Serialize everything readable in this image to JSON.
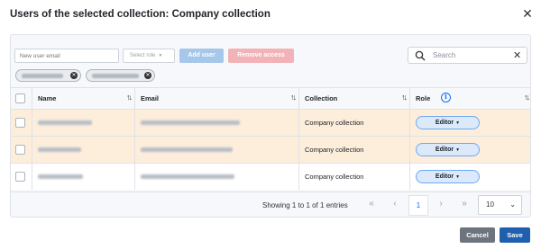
{
  "dialog": {
    "title": "Users of the selected collection: Company collection",
    "close_icon": "close-icon"
  },
  "toolbar": {
    "email_placeholder": "New user email",
    "role_placeholder": "Select role",
    "add_user_label": "Add user",
    "remove_access_label": "Remove access",
    "search_placeholder": "Search"
  },
  "selected_chips": [
    {
      "label": "",
      "remove_icon": "close-icon"
    },
    {
      "label": "",
      "remove_icon": "close-icon"
    }
  ],
  "table": {
    "headers": [
      "Name",
      "Email",
      "Collection",
      "Role"
    ],
    "rows": [
      {
        "name": "",
        "email": "",
        "collection": "Company collection",
        "role": "Editor",
        "highlighted": true
      },
      {
        "name": "",
        "email": "",
        "collection": "Company collection",
        "role": "Editor",
        "highlighted": true
      },
      {
        "name": "",
        "email": "",
        "collection": "Company collection",
        "role": "Editor",
        "highlighted": false
      }
    ]
  },
  "pagination": {
    "summary": "Showing 1 to 1 of 1 entries",
    "current_page": "1",
    "page_size": "10"
  },
  "footer": {
    "cancel_label": "Cancel",
    "save_label": "Save"
  },
  "colors": {
    "highlight_row": "#fdeedc",
    "primary": "#1f5fae",
    "add_button": "#a7c7ea",
    "remove_button": "#f2b3b8"
  }
}
